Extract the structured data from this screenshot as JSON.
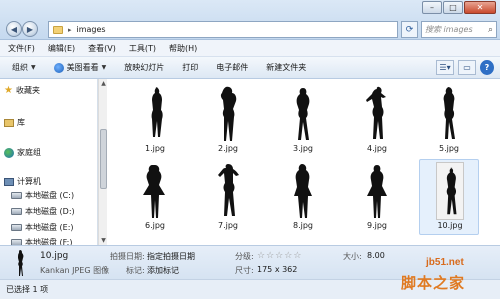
{
  "address": {
    "crumb": "images"
  },
  "search": {
    "placeholder": "搜索 images"
  },
  "window": {
    "minimize": "–",
    "maximize": "□",
    "close": "✕"
  },
  "menu": [
    "文件(F)",
    "编辑(E)",
    "查看(V)",
    "工具(T)",
    "帮助(H)"
  ],
  "toolbar": {
    "organize": "组织",
    "open_with": "美图看看",
    "slideshow": "放映幻灯片",
    "print": "打印",
    "email": "电子邮件",
    "new_folder": "新建文件夹"
  },
  "nav": {
    "favorites": "收藏夹",
    "libraries": "库",
    "homegroup": "家庭组",
    "computer": "计算机",
    "drives": [
      "本地磁盘 (C:)",
      "本地磁盘 (D:)",
      "本地磁盘 (E:)",
      "本地磁盘 (F:)"
    ]
  },
  "files": [
    "1.jpg",
    "2.jpg",
    "3.jpg",
    "4.jpg",
    "5.jpg",
    "6.jpg",
    "7.jpg",
    "8.jpg",
    "9.jpg",
    "10.jpg"
  ],
  "selected_file": "10.jpg",
  "details": {
    "name": "10.jpg",
    "type": "Kankan JPEG 图像",
    "date_label": "拍摄日期:",
    "date_value": "指定拍摄日期",
    "tags_label": "标记:",
    "tags_value": "添加标记",
    "rating_label": "分级:",
    "rating": 0,
    "dimensions_label": "尺寸:",
    "dimensions_value": "175 x 362",
    "size_label": "大小:",
    "size_value": "8.00"
  },
  "status": "已选择 1 项",
  "watermark": {
    "url": "jb51.net",
    "text": "脚本之家"
  },
  "icons": [
    "back-icon",
    "forward-icon",
    "folder-icon",
    "refresh-icon",
    "search-icon",
    "star-icon",
    "library-icon",
    "homegroup-icon",
    "computer-icon",
    "drive-icon",
    "view-icon",
    "help-icon"
  ]
}
